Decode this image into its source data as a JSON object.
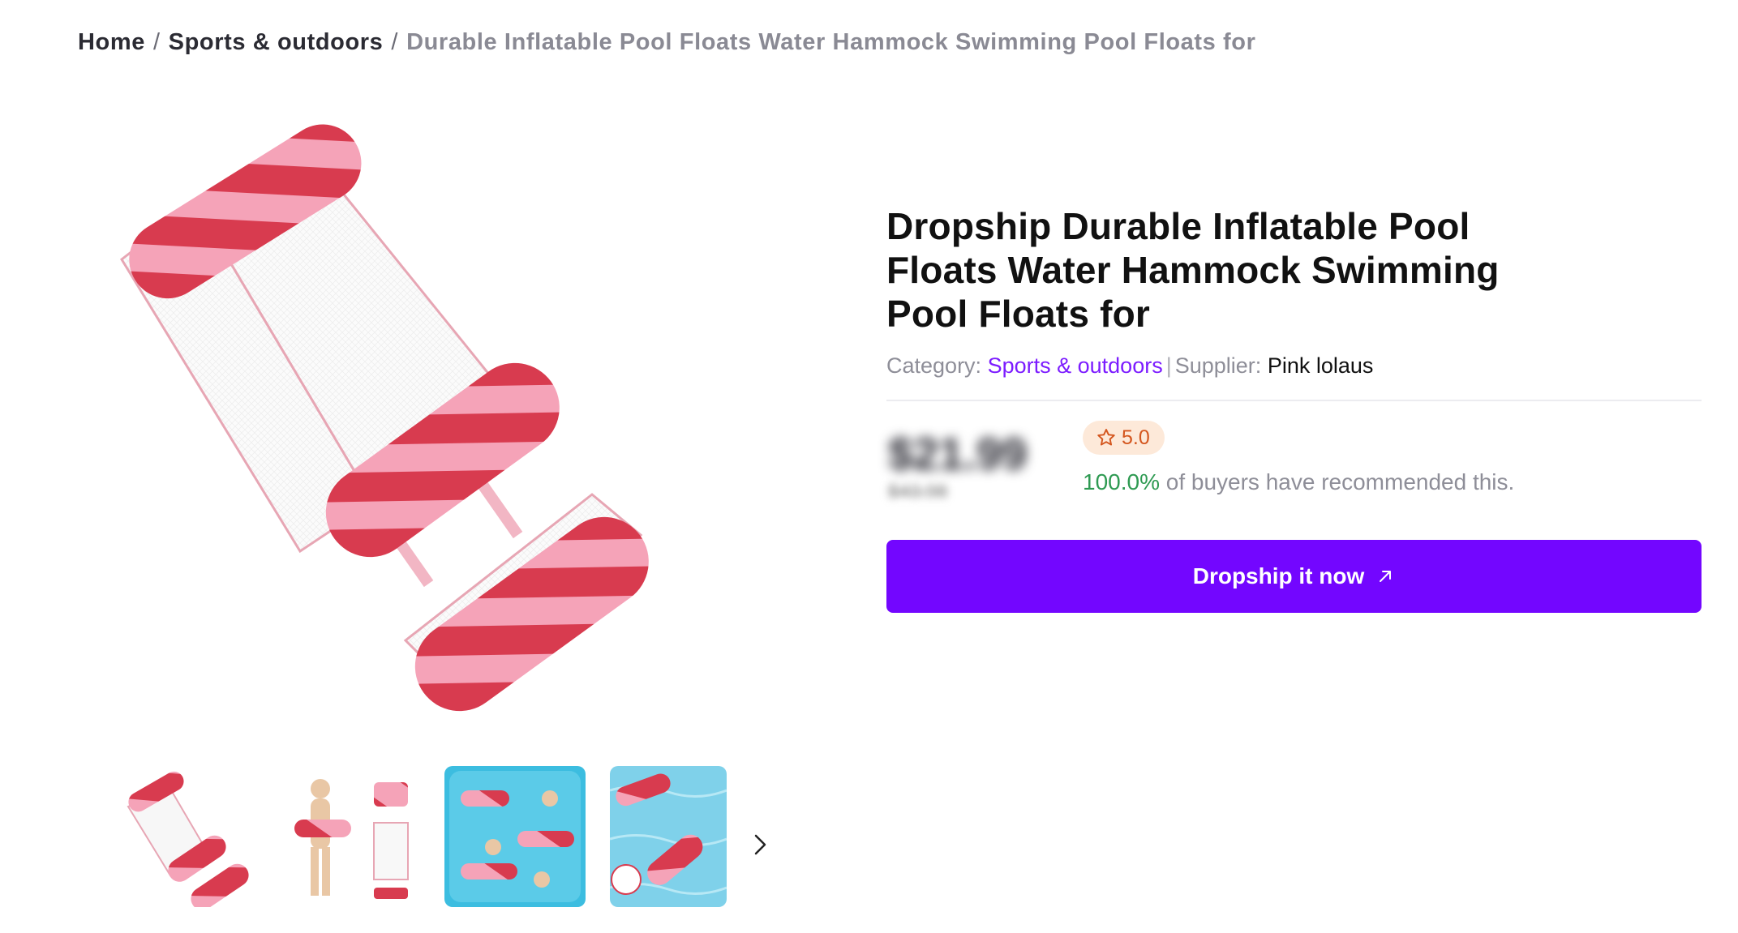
{
  "breadcrumb": {
    "home": "Home",
    "category": "Sports & outdoors",
    "current": "Durable Inflatable Pool Floats Water Hammock Swimming Pool Floats for",
    "separator": "/"
  },
  "product": {
    "title": "Dropship Durable Inflatable Pool Floats Water Hammock Swimming Pool Floats for",
    "category_label": "Category:",
    "category_value": "Sports & outdoors",
    "meta_separator": "|",
    "supplier_label": "Supplier:",
    "supplier_value": "Pink lolaus",
    "price": "$21.99",
    "old_price": "$43.98",
    "rating": "5.0",
    "recommend_pct": "100.0%",
    "recommend_text": "of buyers have recommended this."
  },
  "cta": {
    "label": "Dropship it now"
  },
  "thumbnails": [
    {
      "name": "thumbnail-float"
    },
    {
      "name": "thumbnail-model"
    },
    {
      "name": "thumbnail-usage"
    },
    {
      "name": "thumbnail-pool"
    }
  ],
  "colors": {
    "accent": "#7306ff",
    "link": "#7c1cff",
    "positive": "#2e9a52",
    "rating_bg": "#fde9d9",
    "rating_text": "#d4561e",
    "float_red": "#d83b4f",
    "float_pink": "#f5a3b8"
  },
  "icons": {
    "rating": "star-outline-icon",
    "cta": "arrow-up-right-icon",
    "carousel_next": "chevron-right-icon"
  }
}
